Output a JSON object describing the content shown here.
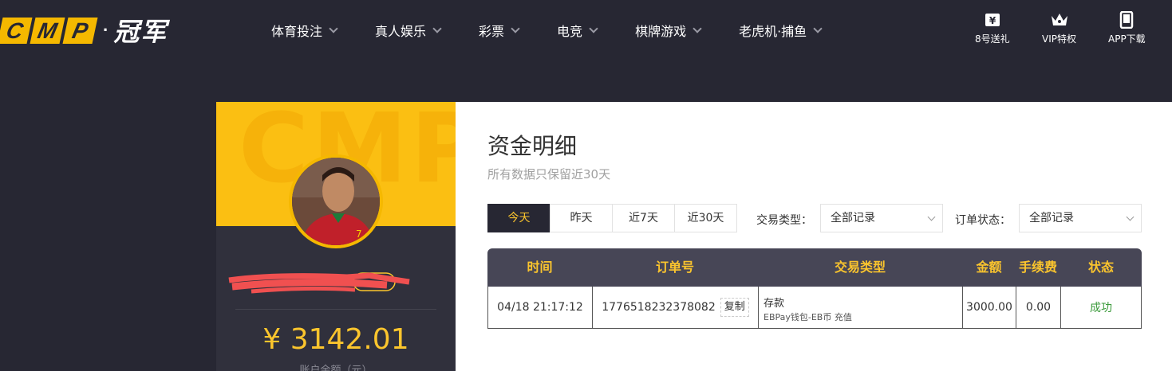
{
  "logo": {
    "letters": [
      "C",
      "M",
      "P"
    ],
    "dot": "·",
    "name": "冠军"
  },
  "nav": [
    {
      "label": "体育投注"
    },
    {
      "label": "真人娱乐"
    },
    {
      "label": "彩票"
    },
    {
      "label": "电竞"
    },
    {
      "label": "棋牌游戏"
    },
    {
      "label": "老虎机·捕鱼"
    }
  ],
  "quick_links": [
    {
      "label": "8号送礼",
      "icon": "gift-ticket-icon"
    },
    {
      "label": "VIP特权",
      "icon": "crown-icon"
    },
    {
      "label": "APP下载",
      "icon": "phone-icon"
    }
  ],
  "sidebar": {
    "watermark": "CMP",
    "balance": "¥ 3142.01",
    "balance_label": "账户余额（元）"
  },
  "page": {
    "title": "资金明细",
    "subtitle": "所有数据只保留近30天"
  },
  "date_tabs": [
    {
      "label": "今天",
      "active": true
    },
    {
      "label": "昨天",
      "active": false
    },
    {
      "label": "近7天",
      "active": false
    },
    {
      "label": "近30天",
      "active": false
    }
  ],
  "filters": {
    "type_label": "交易类型：",
    "type_value": "全部记录",
    "status_label": "订单状态：",
    "status_value": "全部记录"
  },
  "table": {
    "headers": [
      "时间",
      "订单号",
      "交易类型",
      "金额",
      "手续费",
      "状态"
    ],
    "rows": [
      {
        "time": "04/18 21:17:12",
        "order_no": "1776518232378082",
        "copy_label": "复制",
        "type_main": "存款",
        "type_sub": "EBPay钱包-EB币 充值",
        "amount": "3000.00",
        "fee": "0.00",
        "status": "成功"
      }
    ]
  },
  "colors": {
    "accent": "#fbc52d",
    "dark_bg": "#272733",
    "table_header": "#474656",
    "success": "#3a9a3a"
  }
}
